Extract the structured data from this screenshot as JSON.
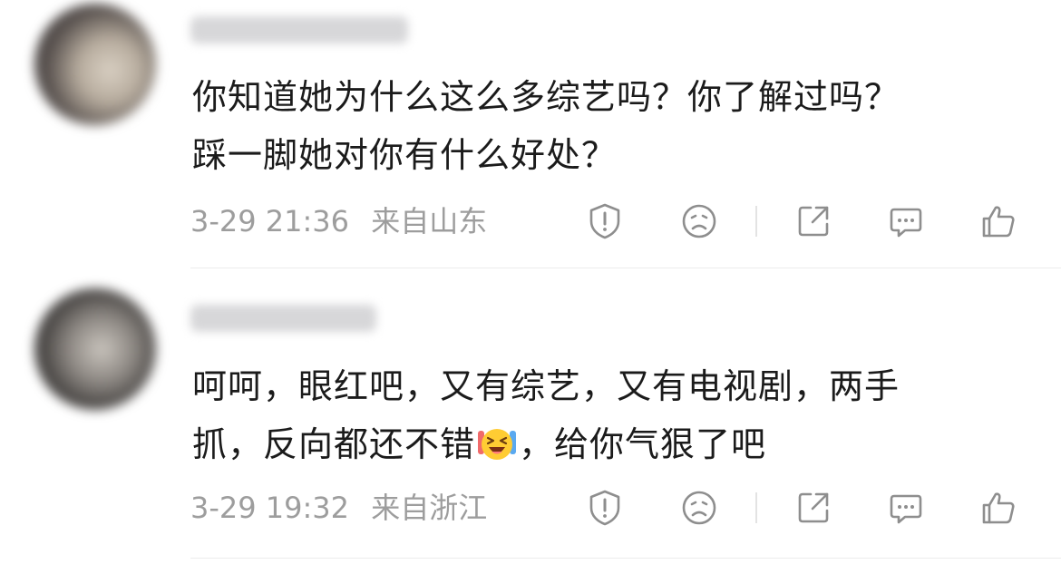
{
  "comments": [
    {
      "text_lines": [
        "你知道她为什么这么多综艺吗？你了解过吗？",
        "踩一脚她对你有什么好处？"
      ],
      "time": "3-29 21:36",
      "location": "来自山东",
      "username_blurred": true
    },
    {
      "text_line1": "呵呵，眼红吧，又有综艺，又有电视剧，两手",
      "text_line2_before_emoji": "抓，反向都还不错",
      "emoji": "laughing-emoji",
      "text_line2_after_emoji": "，给你气狠了吧",
      "time": "3-29 19:32",
      "location": "来自浙江",
      "username_blurred": true
    }
  ],
  "action_icons": [
    "report-icon",
    "dislike-face-icon",
    "share-icon",
    "reply-icon",
    "like-icon"
  ],
  "colors": {
    "text": "#1b1b1b",
    "meta": "#9d9d9d",
    "icon": "#8e8e8e"
  }
}
